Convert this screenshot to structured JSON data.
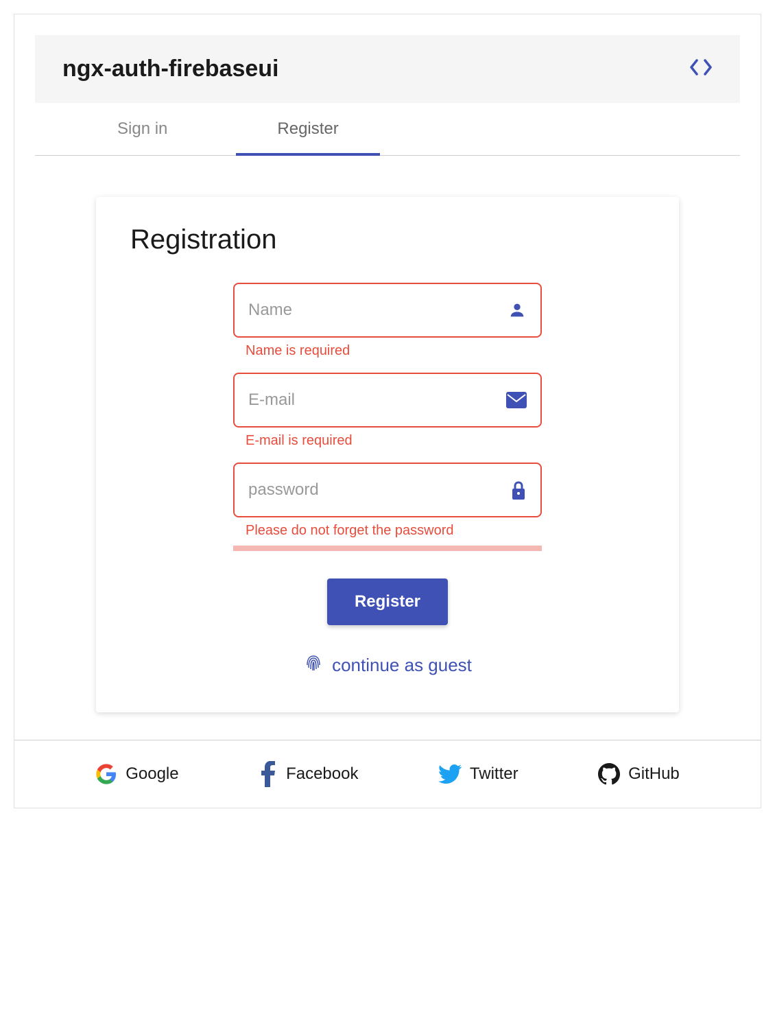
{
  "header": {
    "title": "ngx-auth-firebaseui"
  },
  "tabs": {
    "signin": "Sign in",
    "register": "Register"
  },
  "card": {
    "title": "Registration"
  },
  "fields": {
    "name": {
      "placeholder": "Name",
      "error": "Name is required"
    },
    "email": {
      "placeholder": "E-mail",
      "error": "E-mail is required"
    },
    "password": {
      "placeholder": "password",
      "error": "Please do not forget the password"
    }
  },
  "buttons": {
    "register": "Register",
    "guest": "continue as guest"
  },
  "providers": {
    "google": "Google",
    "facebook": "Facebook",
    "twitter": "Twitter",
    "github": "GitHub"
  },
  "colors": {
    "primary": "#3f51b5",
    "error": "#e74c3c"
  }
}
